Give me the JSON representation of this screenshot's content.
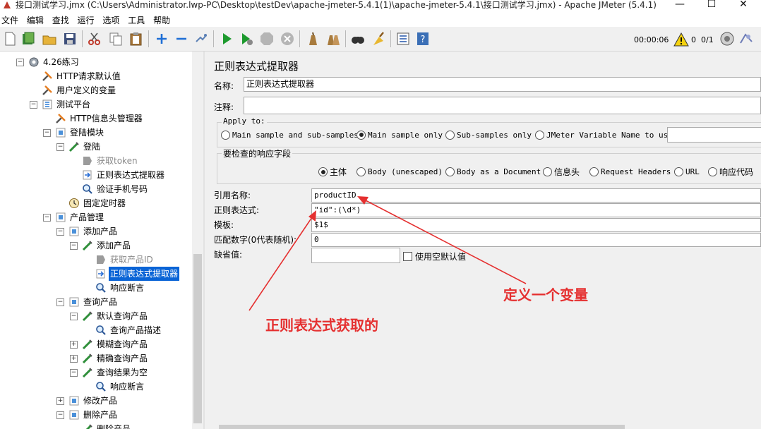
{
  "window": {
    "title": "接口测试学习.jmx (C:\\Users\\Administrator.lwp-PC\\Desktop\\testDev\\apache-jmeter-5.4.1(1)\\apache-jmeter-5.4.1\\接口测试学习.jmx) - Apache JMeter (5.4.1)",
    "minimize": "—",
    "maximize": "☐",
    "close": "✕"
  },
  "menu": [
    "文件",
    "编辑",
    "查找",
    "运行",
    "选项",
    "工具",
    "帮助"
  ],
  "toolbar": {
    "timer": "00:00:06",
    "warn_count": "0",
    "threads": "0/1",
    "icons": [
      "new-icon",
      "templates-icon",
      "open-icon",
      "save-icon",
      "cut-icon",
      "copy-icon",
      "paste-icon",
      "expand-icon",
      "collapse-icon",
      "toggle-icon",
      "start-icon",
      "start-no-pause-icon",
      "stop-icon",
      "shutdown-icon",
      "clear-icon",
      "clear-all-icon",
      "search-icon",
      "reset-search-icon",
      "function-helper-icon",
      "help-icon"
    ]
  },
  "tree": [
    {
      "label": "4.26练习",
      "indent": 0,
      "icon": "gear-icon"
    },
    {
      "label": "HTTP请求默认值",
      "indent": 1,
      "icon": "wrench-icon"
    },
    {
      "label": "用户定义的变量",
      "indent": 1,
      "icon": "wrench-icon"
    },
    {
      "label": "测试平台",
      "indent": 1,
      "icon": "thread-group-icon"
    },
    {
      "label": "HTTP信息头管理器",
      "indent": 2,
      "icon": "wrench-icon"
    },
    {
      "label": "登陆模块",
      "indent": 2,
      "icon": "controller-icon"
    },
    {
      "label": "登陆",
      "indent": 3,
      "icon": "sampler-icon"
    },
    {
      "label": "获取token",
      "indent": 4,
      "icon": "disabled-extractor-icon"
    },
    {
      "label": "正则表达式提取器",
      "indent": 4,
      "icon": "extractor-icon"
    },
    {
      "label": "验证手机号码",
      "indent": 4,
      "icon": "assertion-icon"
    },
    {
      "label": "固定定时器",
      "indent": 3,
      "icon": "timer-icon"
    },
    {
      "label": "产品管理",
      "indent": 2,
      "icon": "controller-icon"
    },
    {
      "label": "添加产品",
      "indent": 3,
      "icon": "controller-icon"
    },
    {
      "label": "添加产品",
      "indent": 4,
      "icon": "sampler-icon"
    },
    {
      "label": "获取产品ID",
      "indent": 5,
      "icon": "disabled-extractor-icon"
    },
    {
      "label": "正则表达式提取器",
      "indent": 5,
      "icon": "extractor-icon"
    },
    {
      "label": "响应断言",
      "indent": 5,
      "icon": "assertion-icon"
    },
    {
      "label": "查询产品",
      "indent": 3,
      "icon": "controller-icon"
    },
    {
      "label": "默认查询产品",
      "indent": 4,
      "icon": "sampler-icon"
    },
    {
      "label": "查询产品描述",
      "indent": 5,
      "icon": "assertion-icon"
    },
    {
      "label": "模糊查询产品",
      "indent": 4,
      "icon": "sampler-icon"
    },
    {
      "label": "精确查询产品",
      "indent": 4,
      "icon": "sampler-icon"
    },
    {
      "label": "查询结果为空",
      "indent": 4,
      "icon": "sampler-icon"
    },
    {
      "label": "响应断言",
      "indent": 5,
      "icon": "assertion-icon"
    },
    {
      "label": "修改产品",
      "indent": 3,
      "icon": "controller-icon"
    },
    {
      "label": "删除产品",
      "indent": 3,
      "icon": "controller-icon"
    },
    {
      "label": "删除产品",
      "indent": 4,
      "icon": "sampler-icon"
    }
  ],
  "panel": {
    "title": "正则表达式提取器",
    "name_label": "名称:",
    "name_value": "正则表达式提取器",
    "comment_label": "注释:",
    "comment_value": "",
    "apply_to": {
      "legend": "Apply to:",
      "options": [
        "Main sample and sub-samples",
        "Main sample only",
        "Sub-samples only",
        "JMeter Variable Name to use"
      ],
      "selected": "Main sample only"
    },
    "field_to_check": {
      "legend": "要检查的响应字段",
      "options": [
        "主体",
        "Body (unescaped)",
        "Body as a Document",
        "信息头",
        "Request Headers",
        "URL",
        "响应代码"
      ],
      "selected": "主体"
    },
    "ref_name_label": "引用名称:",
    "ref_name_value": "productID",
    "regex_label": "正则表达式:",
    "regex_value": "\"id\":(\\d*)",
    "template_label": "模板:",
    "template_value": "$1$",
    "match_no_label": "匹配数字(0代表随机):",
    "match_no_value": "0",
    "default_label": "缺省值:",
    "default_value": "",
    "use_empty_default_label": "使用空默认值"
  },
  "annotations": {
    "define_variable": "定义一个变量",
    "regex_obtained": "正则表达式获取的",
    "color": "#e53030"
  }
}
